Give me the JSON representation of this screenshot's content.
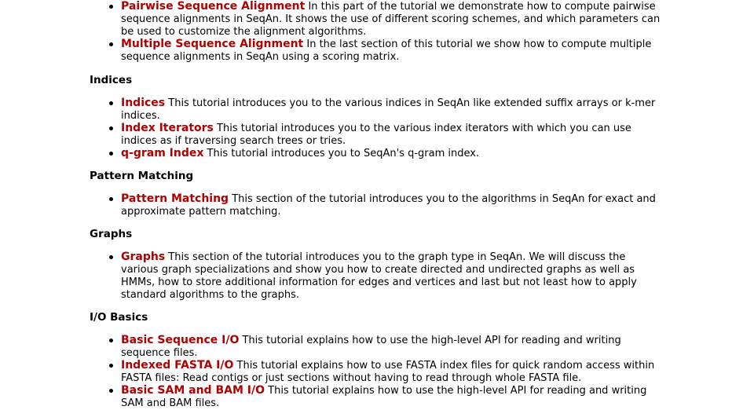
{
  "sections": [
    {
      "heading": "",
      "items": [
        {
          "link": "Pairwise Sequence Alignment",
          "desc": " In this part of the tutorial we demonstrate how to compute pairwise sequence alignments in SeqAn. It shows the use of different scoring schemes, and which parameters can be used to customize the alignment algorithms."
        },
        {
          "link": "Multiple Sequence Alignment",
          "desc": " In the last section of this tutorial we show how to compute multiple sequence alignments in SeqAn using a scoring matrix."
        }
      ]
    },
    {
      "heading": "Indices",
      "items": [
        {
          "link": "Indices",
          "desc": " This tutorial introduces you to the various indices in SeqAn like extended suffix arrays or k-mer indices."
        },
        {
          "link": "Index Iterators",
          "desc": " This tutorial introduces you to the various index iterators with which you can use indices as if traversing search trees or tries."
        },
        {
          "link": "q-gram Index",
          "desc": " This tutorial introduces you to SeqAn's q-gram index."
        }
      ]
    },
    {
      "heading": "Pattern Matching",
      "items": [
        {
          "link": "Pattern Matching",
          "desc": " This section of the tutorial introduces you to the algorithms in SeqAn for exact and approximate pattern matching."
        }
      ]
    },
    {
      "heading": "Graphs",
      "items": [
        {
          "link": "Graphs",
          "desc": " This section of the tutorial introduces you to the graph type in SeqAn. We will discuss the various graph specializations and show you how to create directed and undirected graphs as well as HMMs, how to store additional information for edges and vertices and last but not least how to apply standard algorithms to the graphs."
        }
      ]
    },
    {
      "heading": "I/O Basics",
      "items": [
        {
          "link": "Basic Sequence I/O",
          "desc": " This tutorial explains how to use the high-level API for reading and writing sequence files."
        },
        {
          "link": "Indexed FASTA I/O",
          "desc": " This tutorial explains how to use FASTA index files for quick random access within FASTA files: Read contigs or just sections without having to read through whole FASTA file."
        },
        {
          "link": "Basic SAM and BAM I/O",
          "desc": " This tutorial explains how to use the high-level API for reading and writing SAM and BAM files."
        }
      ]
    }
  ]
}
